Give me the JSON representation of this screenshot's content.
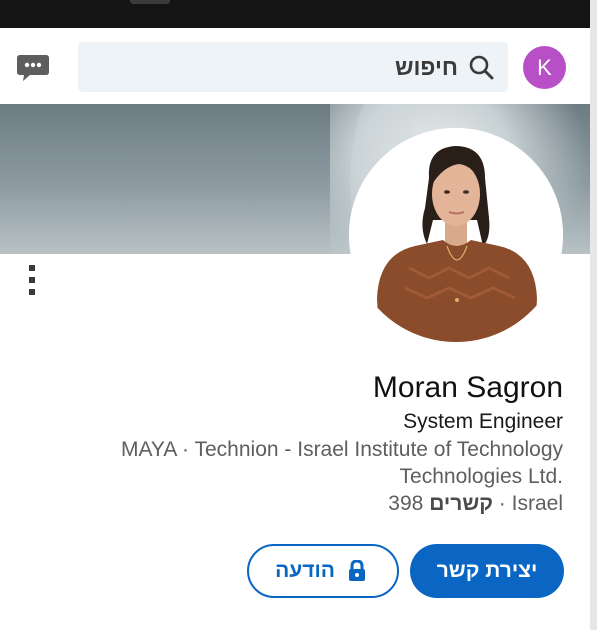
{
  "header": {
    "search_text": "חיפוש",
    "avatar_initial": "K",
    "icons": {
      "messaging": "message-bubble-icon",
      "search": "search-icon",
      "lock": "lock-icon",
      "more": "more-vertical-icon"
    }
  },
  "profile": {
    "name": "Moran Sagron",
    "headline": "System Engineer",
    "company_line": "MAYA  ·  Technion - Israel Institute of Technology",
    "company_line2": "Technologies Ltd.",
    "connections_count": "398",
    "connections_label": "קשרים",
    "separator": " · ",
    "location": "Israel"
  },
  "actions": {
    "connect_label": "יצירת קשר",
    "message_label": "הודעה"
  },
  "colors": {
    "accent": "#0a66c2",
    "avatar_bg": "#b94fc6",
    "search_bg": "#eef3f8"
  }
}
